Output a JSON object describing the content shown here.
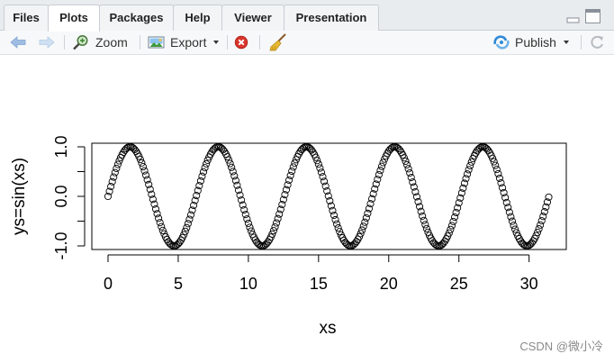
{
  "tabs": [
    {
      "label": "Files",
      "active": false
    },
    {
      "label": "Plots",
      "active": true
    },
    {
      "label": "Packages",
      "active": false
    },
    {
      "label": "Help",
      "active": false
    },
    {
      "label": "Viewer",
      "active": false
    },
    {
      "label": "Presentation",
      "active": false
    }
  ],
  "toolbar": {
    "zoom_label": "Zoom",
    "export_label": "Export",
    "publish_label": "Publish"
  },
  "colors": {
    "back_arrow": "#9fbde3",
    "forward_arrow": "#cfe0f2",
    "clear_icon": "#d9342b",
    "publish_icon": "#2e8bd8"
  },
  "chart_data": {
    "type": "scatter",
    "title": "",
    "xlabel": "xs",
    "ylabel": "ys=sin(xs)",
    "x_function": "xs = seq(0, 10*pi, by = 0.1)",
    "y_function": "ys = sin(xs)",
    "x_start": 0,
    "x_end": 31.4,
    "x_step": 0.1,
    "xlim": [
      0,
      31.4
    ],
    "ylim": [
      -1,
      1
    ],
    "x_ticks": [
      0,
      5,
      10,
      15,
      20,
      25,
      30
    ],
    "x_tick_labels": [
      "0",
      "5",
      "10",
      "15",
      "20",
      "25",
      "30"
    ],
    "y_ticks": [
      -1,
      -0.5,
      0,
      0.5,
      1
    ],
    "y_tick_labels": [
      "-1.0",
      "",
      "0.0",
      "",
      "1.0"
    ],
    "marker": "open-circle",
    "grid": false
  },
  "watermark": "CSDN @微小冷"
}
